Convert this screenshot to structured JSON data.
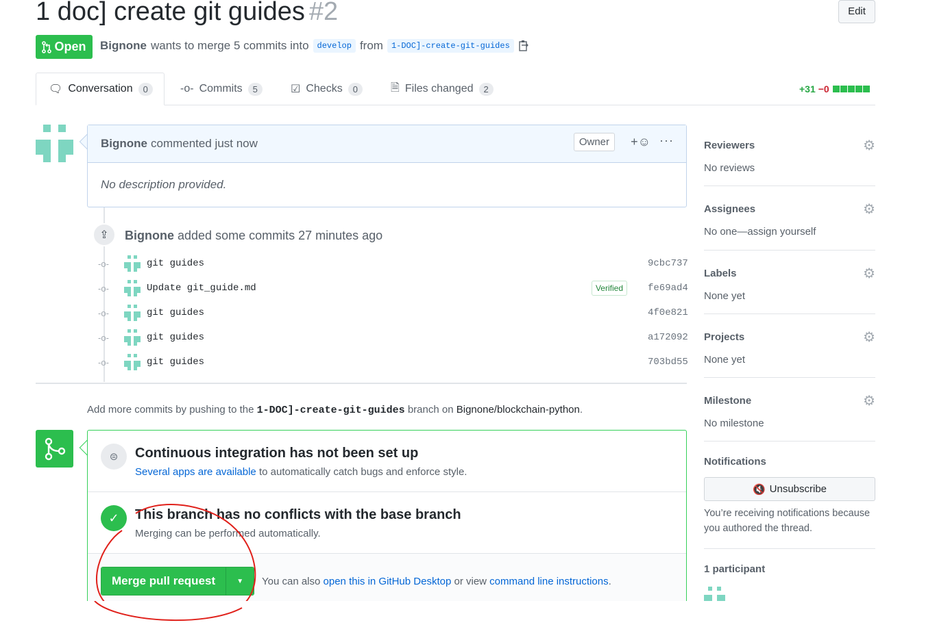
{
  "header": {
    "title": "1 doc] create git guides",
    "number": "#2",
    "edit_label": "Edit",
    "state": "Open",
    "author": "Bignone",
    "merge_text_1": "wants to merge 5 commits into",
    "base_branch": "develop",
    "merge_text_2": "from",
    "head_branch": "1-DOC]-create-git-guides"
  },
  "tabs": [
    {
      "label": "Conversation",
      "count": "0"
    },
    {
      "label": "Commits",
      "count": "5"
    },
    {
      "label": "Checks",
      "count": "0"
    },
    {
      "label": "Files changed",
      "count": "2"
    }
  ],
  "diffstat": {
    "additions": "+31",
    "deletions": "−0"
  },
  "comment": {
    "author": "Bignone",
    "action": "commented just now",
    "owner_badge": "Owner",
    "reaction": "+☺",
    "more": "···",
    "body": "No description provided."
  },
  "push_event": {
    "author": "Bignone",
    "text": "added some commits 27 minutes ago"
  },
  "commits": [
    {
      "message": "git guides",
      "sha": "9cbc737",
      "verified": ""
    },
    {
      "message": "Update git_guide.md",
      "sha": "fe69ad4",
      "verified": "Verified"
    },
    {
      "message": "git guides",
      "sha": "4f0e821",
      "verified": ""
    },
    {
      "message": "git guides",
      "sha": "a172092",
      "verified": ""
    },
    {
      "message": "git guides",
      "sha": "703bd55",
      "verified": ""
    }
  ],
  "push_hint": {
    "pre": "Add more commits by pushing to the",
    "branch": "1-DOC]-create-git-guides",
    "mid": "branch on",
    "repo": "Bignone/blockchain-python",
    "post": "."
  },
  "merge_box": {
    "ci_title": "Continuous integration has not been set up",
    "ci_link": "Several apps are available",
    "ci_rest": "to automatically catch bugs and enforce style.",
    "ok_title": "This branch has no conflicts with the base branch",
    "ok_sub": "Merging can be performed automatically.",
    "merge_label": "Merge pull request",
    "alt_pre": "You can also",
    "alt_link1": "open this in GitHub Desktop",
    "alt_mid": "or view",
    "alt_link2": "command line instructions",
    "alt_post": "."
  },
  "sidebar": {
    "reviewers": {
      "label": "Reviewers",
      "value": "No reviews"
    },
    "assignees": {
      "label": "Assignees",
      "value": "No one—assign yourself"
    },
    "labels": {
      "label": "Labels",
      "value": "None yet"
    },
    "projects": {
      "label": "Projects",
      "value": "None yet"
    },
    "milestone": {
      "label": "Milestone",
      "value": "No milestone"
    },
    "notifications": {
      "label": "Notifications",
      "button": "Unsubscribe",
      "text": "You’re receiving notifications because you authored the thread."
    },
    "participants": "1 participant"
  },
  "colors": {
    "accent_green": "#2cbe4e",
    "link_blue": "#0366d6",
    "annotation_red": "#e0201a"
  }
}
